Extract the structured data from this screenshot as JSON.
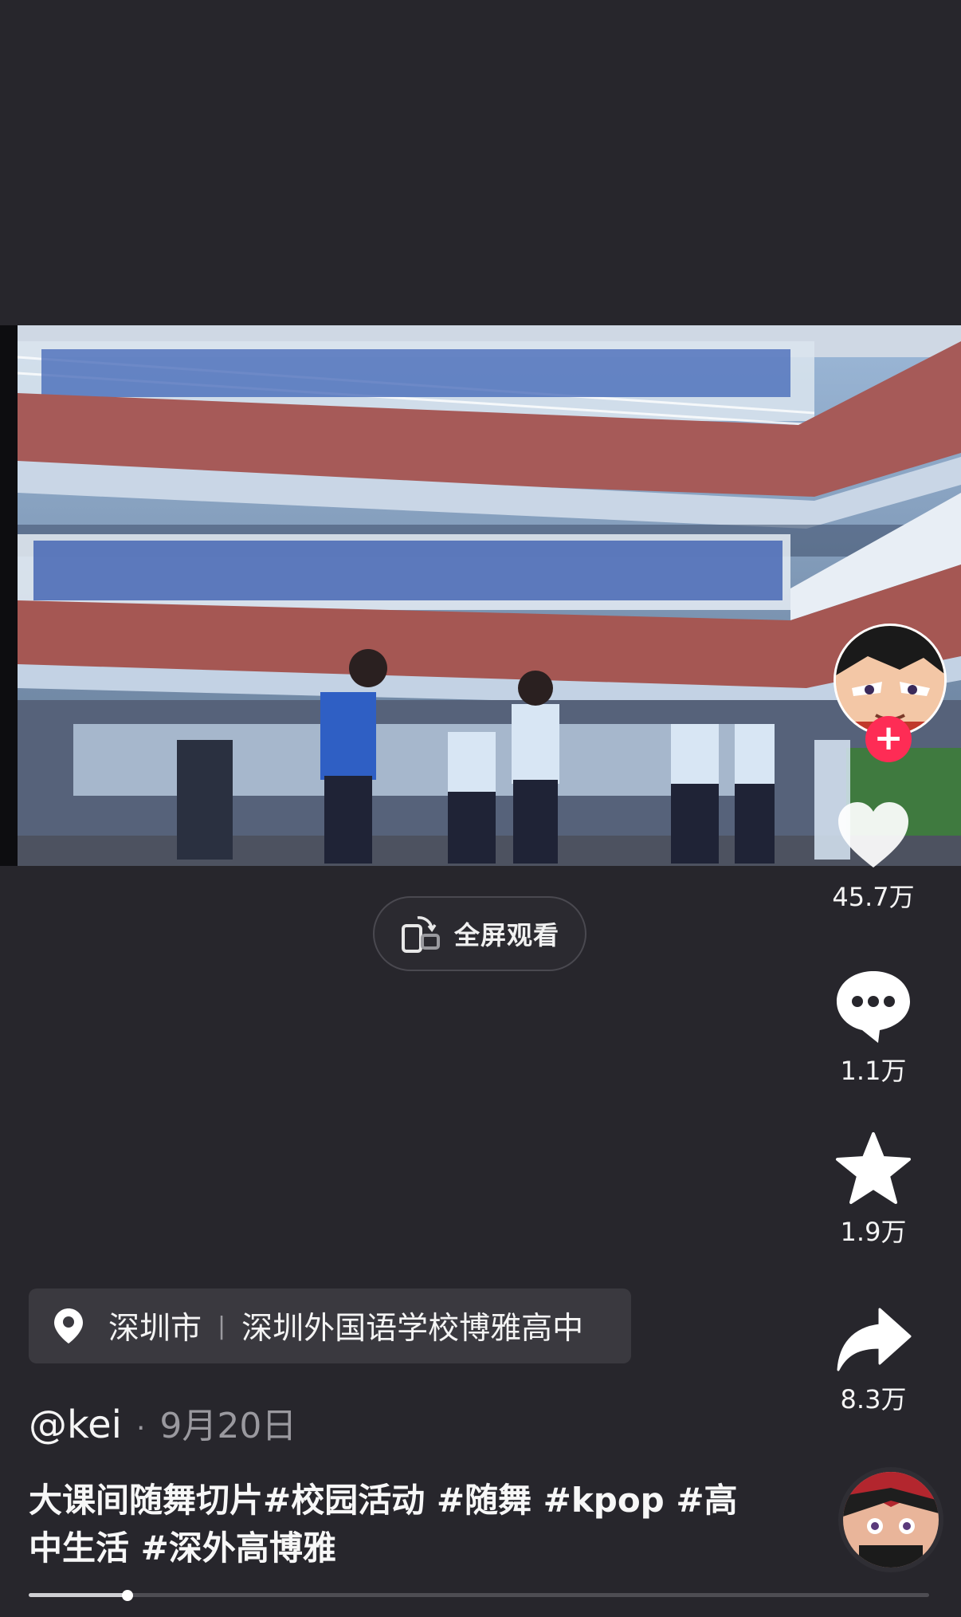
{
  "fullscreen": {
    "label": "全屏观看"
  },
  "actions": {
    "like": {
      "count": "45.7万",
      "icon": "heart-icon"
    },
    "comment": {
      "count": "1.1万",
      "icon": "comment-icon"
    },
    "favorite": {
      "count": "1.9万",
      "icon": "star-icon"
    },
    "share": {
      "count": "8.3万",
      "icon": "share-icon"
    },
    "follow_symbol": "+"
  },
  "location": {
    "city": "深圳市",
    "separator": "|",
    "place": "深圳外国语学校博雅高中"
  },
  "post": {
    "author": "@kei",
    "dot": "·",
    "date": "9月20日",
    "caption": "大课间随舞切片#校园活动 #随舞 #kpop #高中生活 #深外高博雅"
  },
  "progress": {
    "fraction": 0.11
  },
  "colors": {
    "background": "#27262c",
    "follow_accent": "#fe2c55"
  }
}
